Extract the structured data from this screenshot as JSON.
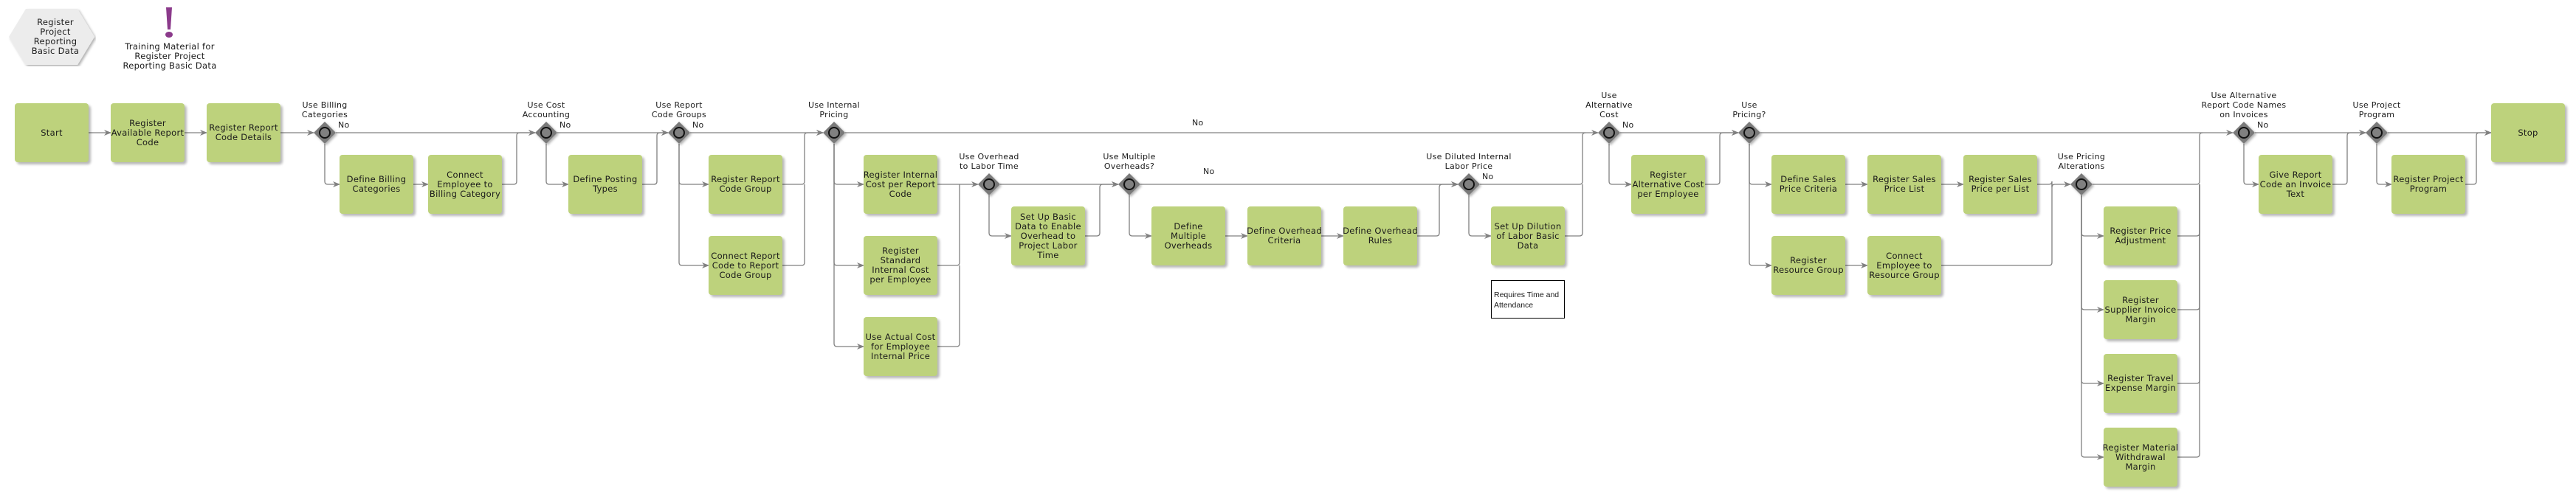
{
  "header": {
    "process_title": "Register\nProject\nReporting\nBasic Data",
    "training_material": "Training Material for\nRegister Project\nReporting Basic Data"
  },
  "colors": {
    "activity_fill": "#bdd27c",
    "gateway_fill": "#7a7a7a",
    "connector": "#808080",
    "training_icon": "#8b3a8b",
    "hexagon_fill": "#ececec"
  },
  "activities": {
    "start": "Start",
    "register_available_report_code": "Register\nAvailable Report\nCode",
    "register_report_code_details": "Register Report\nCode Details",
    "define_billing_categories": "Define Billing\nCategories",
    "connect_employee_billing": "Connect\nEmployee to\nBilling Category",
    "define_posting_types": "Define Posting\nTypes",
    "register_report_code_group": "Register Report\nCode Group",
    "connect_report_code_group": "Connect Report\nCode to Report\nCode Group",
    "register_internal_cost": "Register Internal\nCost per Report\nCode",
    "register_standard_internal_cost": "Register\nStandard\nInternal Cost\nper Employee",
    "use_actual_cost": "Use Actual Cost\nfor Employee\nInternal Price",
    "set_up_basic_overhead": "Set Up Basic\nData to Enable\nOverhead to\nProject Labor\nTime",
    "define_multiple_overheads": "Define\nMultiple\nOverheads",
    "define_overhead_criteria": "Define Overhead\nCriteria",
    "define_overhead_rules": "Define Overhead\nRules",
    "set_up_dilution": "Set Up Dilution\nof Labor Basic\nData",
    "register_alternative_cost": "Register\nAlternative Cost\nper Employee",
    "define_sales_price_criteria": "Define Sales\nPrice Criteria",
    "register_sales_price_list": "Register Sales\nPrice List",
    "register_sales_price_per_list": "Register Sales\nPrice per List",
    "register_resource_group": "Register\nResource Group",
    "connect_employee_resource_group": "Connect\nEmployee to\nResource Group",
    "register_price_adjustment": "Register Price\nAdjustment",
    "register_supplier_invoice_margin": "Register\nSupplier Invoice\nMargin",
    "register_travel_expense_margin": "Register Travel\nExpense Margin",
    "register_material_withdrawal_margin": "Register Material\nWithdrawal\nMargin",
    "give_report_code_invoice_text": "Give Report\nCode an Invoice\nText",
    "register_project_program": "Register Project\nProgram",
    "stop": "Stop"
  },
  "gateways": {
    "use_billing_categories": "Use Billing\nCategories",
    "use_cost_accounting": "Use Cost\nAccounting",
    "use_report_code_groups": "Use Report\nCode Groups",
    "use_internal_pricing": "Use Internal\nPricing",
    "use_overhead_labor_time": "Use Overhead\nto Labor Time",
    "use_multiple_overheads": "Use Multiple\nOverheads?",
    "use_diluted_internal_labor_price": "Use Diluted Internal\nLabor Price",
    "use_alternative_cost": "Use\nAlternative\nCost",
    "use_pricing": "Use\nPricing?",
    "use_pricing_alterations": "Use Pricing\nAlterations",
    "use_alternative_report_code_names": "Use Alternative\nReport Code Names\non Invoices",
    "use_project_program": "Use Project\nProgram"
  },
  "edge_labels": {
    "no": "No"
  },
  "notes": {
    "requires_time_attendance": "Requires Time and\nAttendance"
  }
}
